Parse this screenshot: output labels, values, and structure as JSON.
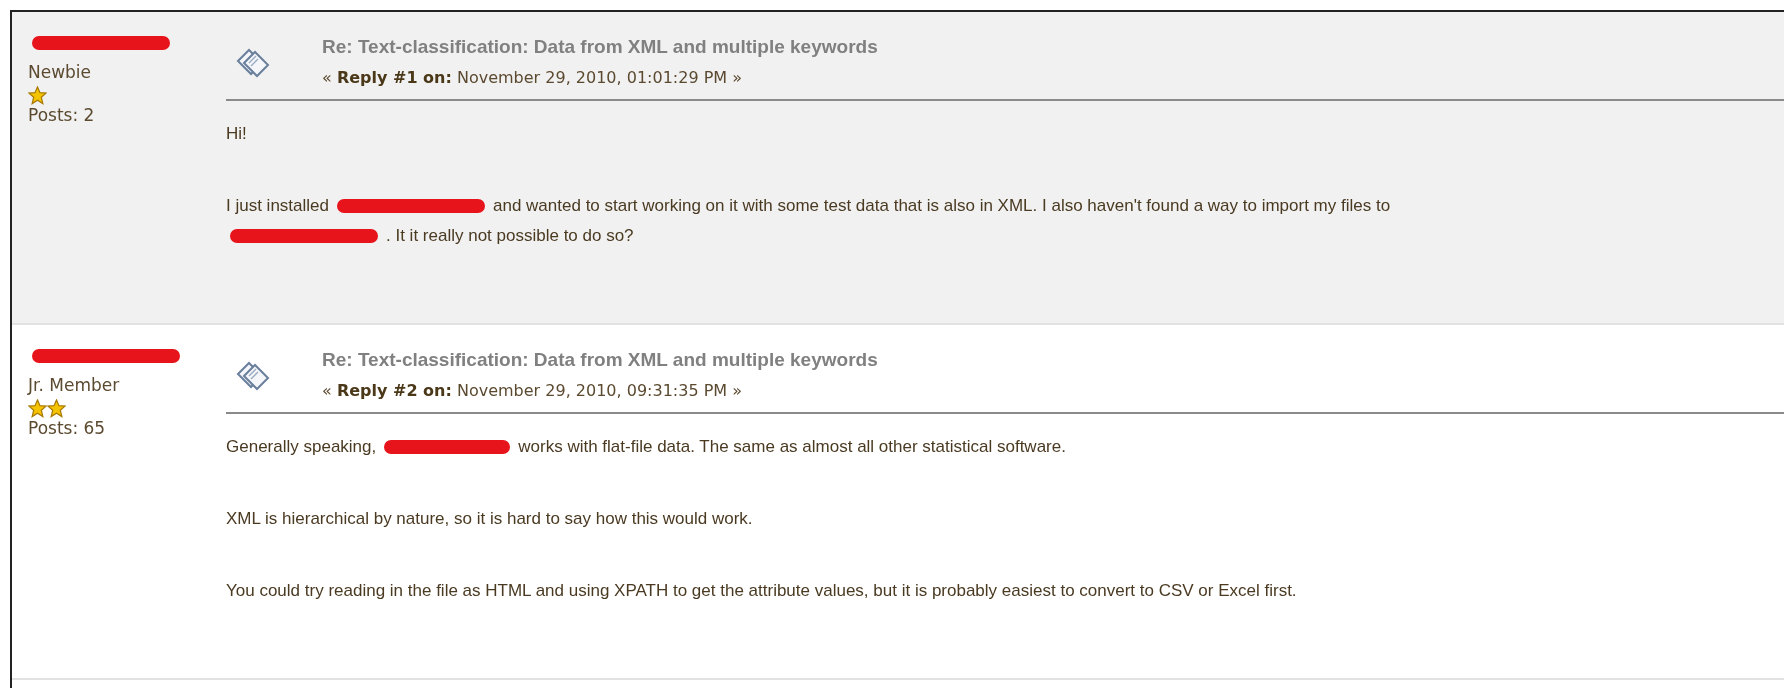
{
  "posts": [
    {
      "author": {
        "rank": "Newbie",
        "rank_icons": [
          {
            "kind": "star"
          }
        ],
        "posts": "Posts: 2"
      },
      "shaded": true,
      "title": "Re: Text-classification: Data from XML and multiple keywords",
      "reply_line": "« **Reply #1 on:** November 29, 2010, 01:01:29 PM »",
      "paragraphs": [
        [
          [
            {
              "kind": "text",
              "text": "Hi!"
            }
          ]
        ],
        [
          [
            {
              "kind": "text",
              "text": "I just installed"
            },
            {
              "kind": "redaction"
            },
            {
              "kind": "text",
              "text": "and wanted to start working on it with some test data that is also in XML. I also haven't found a way to import my files to"
            }
          ],
          [
            {
              "kind": "redaction"
            },
            {
              "kind": "text",
              "text": ". It it really not possible to do so?"
            }
          ]
        ]
      ]
    },
    {
      "author": {
        "rank": "Jr. Member",
        "rank_icons": [
          {
            "kind": "star"
          },
          {
            "kind": "star"
          }
        ],
        "posts": "Posts: 65"
      },
      "shaded": false,
      "title": "Re: Text-classification: Data from XML and multiple keywords",
      "reply_line": "« **Reply #2 on:** November 29, 2010, 09:31:35 PM »",
      "paragraphs": [
        [
          [
            {
              "kind": "text",
              "text": "Generally speaking,"
            },
            {
              "kind": "redaction"
            },
            {
              "kind": "text",
              "text": "works with flat-file data. The same as almost all other statistical software."
            }
          ]
        ],
        [
          [
            {
              "kind": "text",
              "text": "XML is hierarchical by nature, so it is hard to say how this would work."
            }
          ]
        ],
        [
          [
            {
              "kind": "text",
              "text": "You could try reading in the file as HTML and using XPATH to get the attribute values, but it is probably easiest to convert to CSV or Excel first."
            }
          ]
        ]
      ]
    }
  ]
}
